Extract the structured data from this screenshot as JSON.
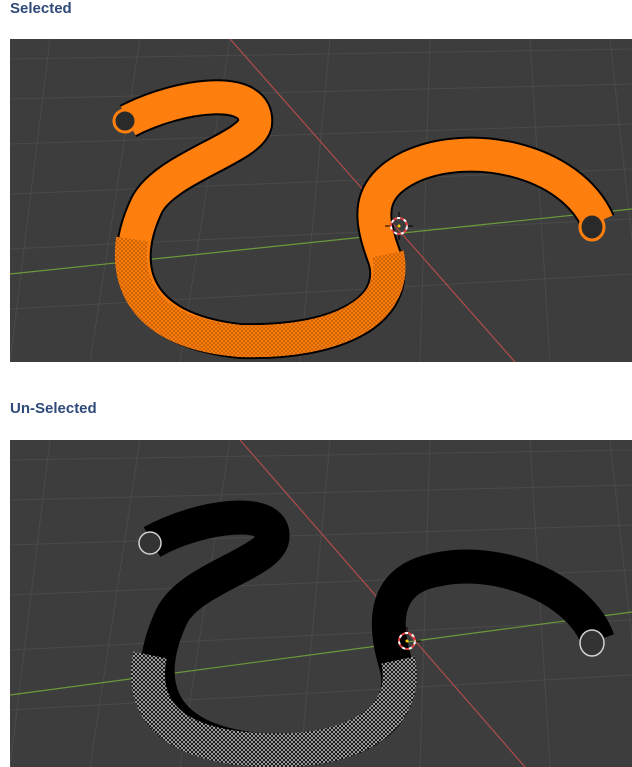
{
  "sections": {
    "selected": {
      "title": "Selected",
      "state": "selected",
      "tube_color": "#ff7f0e",
      "edge_color": "#000000"
    },
    "unselected": {
      "title": "Un-Selected",
      "state": "unselected",
      "tube_color": "#000000",
      "edge_color": "#d0d0d0"
    }
  },
  "viewport": {
    "background": "#3d3d3d",
    "grid_color": "#4a4a4a",
    "x_axis_color": "#b04b4b",
    "y_axis_color": "#6b9a3a",
    "cursor_icon": "3d-cursor-icon"
  }
}
